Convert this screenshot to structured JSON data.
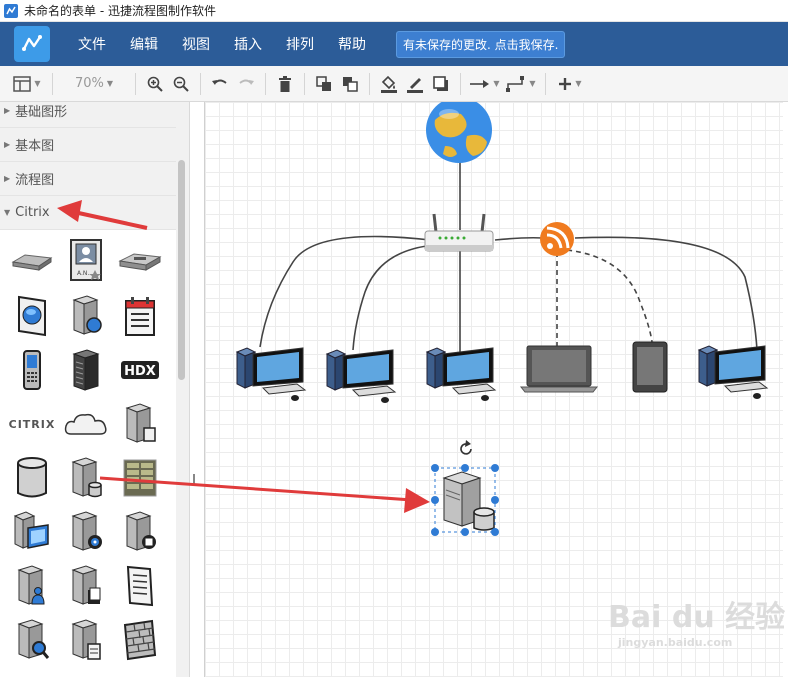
{
  "window": {
    "title": "未命名的表单 - 迅捷流程图制作软件"
  },
  "menubar": {
    "items": [
      "文件",
      "编辑",
      "视图",
      "插入",
      "排列",
      "帮助"
    ],
    "unsaved_notice": "有未保存的更改. 点击我保存."
  },
  "toolbar": {
    "zoom": "70%",
    "buttons": [
      "page-layout-icon",
      "zoom-in-icon",
      "zoom-out-icon",
      "undo-icon",
      "redo-icon",
      "delete-icon",
      "to-front-icon",
      "to-back-icon",
      "fill-color-icon",
      "line-color-icon",
      "shadow-icon",
      "connection-arrow-icon",
      "waypoint-icon",
      "insert-plus-icon"
    ]
  },
  "sidebar": {
    "categories": [
      {
        "label": "基础图形",
        "expanded": false
      },
      {
        "label": "基本图",
        "expanded": false
      },
      {
        "label": "流程图",
        "expanded": false
      },
      {
        "label": "Citrix",
        "expanded": true
      }
    ],
    "citrix_shapes": [
      "netscaler-icon",
      "id-badge-icon",
      "rack-appliance-icon",
      "web-browser-icon",
      "server-globe-icon",
      "calendar-icon",
      "mobile-phone-icon",
      "datacenter-server-icon",
      "hdx-icon",
      "citrix-logo-icon",
      "cloud-icon",
      "server-document-icon",
      "database-icon",
      "database-server-icon",
      "server-rack-icon",
      "desktop-server-icon",
      "server-disc-icon",
      "server-app-icon",
      "server-user-icon",
      "server-files-icon",
      "document-icon",
      "server-search-icon",
      "server-notepad-icon",
      "firewall-icon"
    ],
    "hdx_label": "HDX",
    "citrix_label": "CITRIX"
  },
  "canvas": {
    "nodes": [
      "globe-icon",
      "router-icon",
      "rss-icon",
      "desktop-computer-1",
      "desktop-computer-2",
      "desktop-computer-3",
      "laptop-icon",
      "tablet-icon",
      "desktop-computer-4",
      "database-server-selected"
    ]
  },
  "watermark": {
    "main": "Bai du 经验",
    "sub": "jingyan.baidu.com"
  },
  "colors": {
    "menubar": "#2c5c98",
    "accent": "#3d9be8",
    "annotation_arrow": "#e03b3b",
    "selection": "#2f7bd4"
  }
}
